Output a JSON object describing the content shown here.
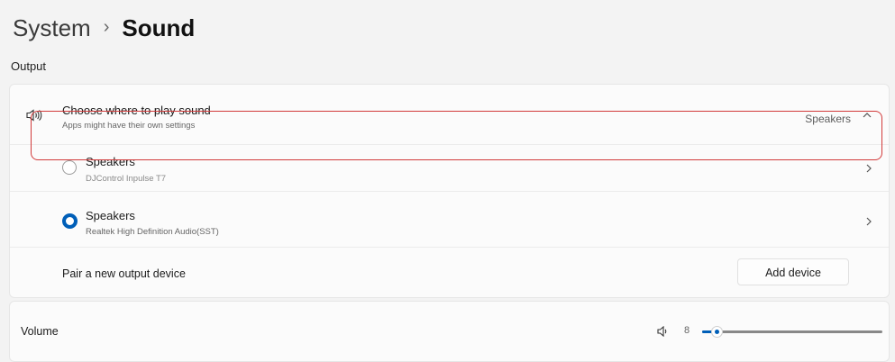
{
  "breadcrumb": {
    "parent": "System",
    "separator": "›",
    "current": "Sound"
  },
  "output": {
    "section_label": "Output",
    "choose": {
      "title": "Choose where to play sound",
      "subtitle": "Apps might have their own settings",
      "selected_value": "Speakers",
      "icon": "speaker-icon"
    },
    "devices": [
      {
        "name": "Speakers",
        "detail": "DJControl Inpulse T7",
        "selected": false
      },
      {
        "name": "Speakers",
        "detail": "Realtek High Definition Audio(SST)",
        "selected": true
      }
    ],
    "pair": {
      "label": "Pair a new output device",
      "button": "Add device"
    }
  },
  "volume": {
    "label": "Volume",
    "value": "8",
    "level": 8,
    "icon": "volume-icon"
  },
  "colors": {
    "accent": "#005fb8",
    "highlight_border": "#d23a3a"
  }
}
